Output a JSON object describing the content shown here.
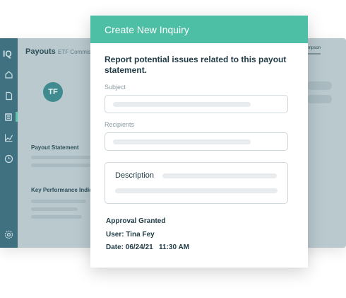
{
  "background_app": {
    "logo": "IQ",
    "page_title": "Payouts",
    "page_subtitle": "ETF Commis",
    "user_name": "pnpson",
    "avatar_initials": "TF",
    "sections": {
      "payout_statement": "Payout Statement",
      "key_performance": "Key Performance Indic"
    },
    "nav_icons": [
      "home-icon",
      "document-icon",
      "calculator-icon",
      "chart-icon",
      "clock-icon"
    ],
    "settings_icon": "gear-icon"
  },
  "modal": {
    "header_title": "Create New Inquiry",
    "intro": "Report potential issues related to this payout statement.",
    "subject_label": "Subject",
    "recipients_label": "Recipients",
    "description_label": "Description",
    "approval_status": "Approval Granted",
    "approval_user": "User: Tina Fey",
    "approval_date": "Date: 06/24/21   11:30 AM"
  },
  "colors": {
    "accent": "#4dbfa5",
    "sidebar": "#3f7180",
    "text_dark": "#1f3a44"
  }
}
